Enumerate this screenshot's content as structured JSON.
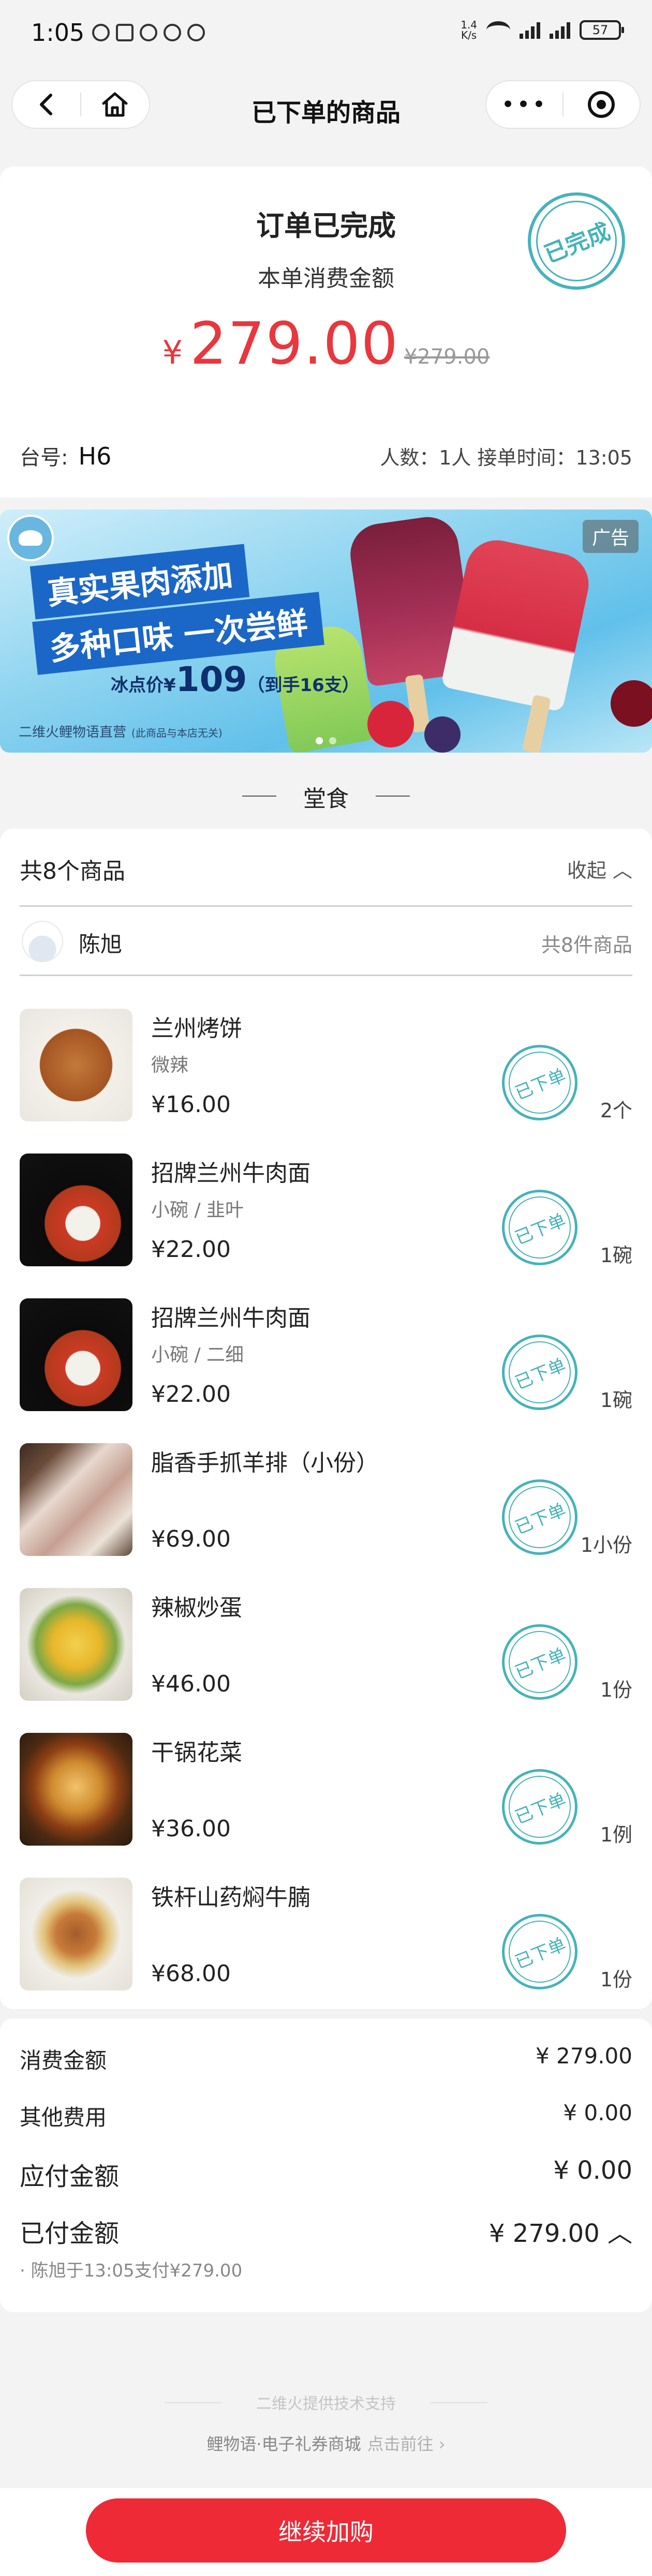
{
  "status_bar": {
    "time": "1:05",
    "net_speed_top": "1.4",
    "net_speed_bottom": "K/s",
    "battery": "57"
  },
  "nav": {
    "title": "已下单的商品"
  },
  "order": {
    "title": "订单已完成",
    "subtitle": "本单消费金额",
    "currency": "¥",
    "amount": "279.00",
    "original_price": "¥279.00",
    "stamp": "已完成",
    "table_label": "台号:",
    "table_value": "H6",
    "meta": "人数：1人    接单时间：13:05"
  },
  "ad": {
    "headline_1": "真实果肉添加",
    "headline_2": "多种口味 一次尝鲜",
    "price_prefix": "冰点价¥",
    "price_value": "109",
    "price_suffix": "（到手16支）",
    "footer": "二维火鲤物语直营",
    "footer_note": "(此商品与本店无关)",
    "badge": "广告"
  },
  "dine_type": "堂食",
  "items_section": {
    "count_label": "共8个商品",
    "collapse_label": "收起 ︿",
    "user_name": "陈旭",
    "user_count": "共8件商品",
    "stamp_text": "已下单",
    "items": [
      {
        "name": "兰州烤饼",
        "spec": "微辣",
        "price": "¥16.00",
        "qty": "2个"
      },
      {
        "name": "招牌兰州牛肉面",
        "spec": "小碗 / 韭叶",
        "price": "¥22.00",
        "qty": "1碗"
      },
      {
        "name": "招牌兰州牛肉面",
        "spec": "小碗 / 二细",
        "price": "¥22.00",
        "qty": "1碗"
      },
      {
        "name": "脂香手抓羊排（小份）",
        "spec": "",
        "price": "¥69.00",
        "qty": "1小份"
      },
      {
        "name": "辣椒炒蛋",
        "spec": "",
        "price": "¥46.00",
        "qty": "1份"
      },
      {
        "name": "干锅花菜",
        "spec": "",
        "price": "¥36.00",
        "qty": "1例"
      },
      {
        "name": "铁杆山药焖牛腩",
        "spec": "",
        "price": "¥68.00",
        "qty": "1份"
      }
    ]
  },
  "summary": {
    "consumption_label": "消费金额",
    "consumption_value": "¥ 279.00",
    "other_label": "其他费用",
    "other_value": "¥ 0.00",
    "payable_label": "应付金额",
    "payable_value": "¥ 0.00",
    "paid_label": "已付金额",
    "paid_value": "¥ 279.00 ︿",
    "paid_note": "· 陈旭于13:05支付¥279.00"
  },
  "footer": {
    "brand": "二维火提供技术支持",
    "link": "鲤物语·电子礼券商城",
    "link_go": "点击前往 ›"
  },
  "bottom": {
    "continue_label": "继续加购"
  },
  "colors": {
    "accent_red": "#ee2a36",
    "price_red": "#e8373d",
    "stamp_teal": "#45b3b9"
  }
}
